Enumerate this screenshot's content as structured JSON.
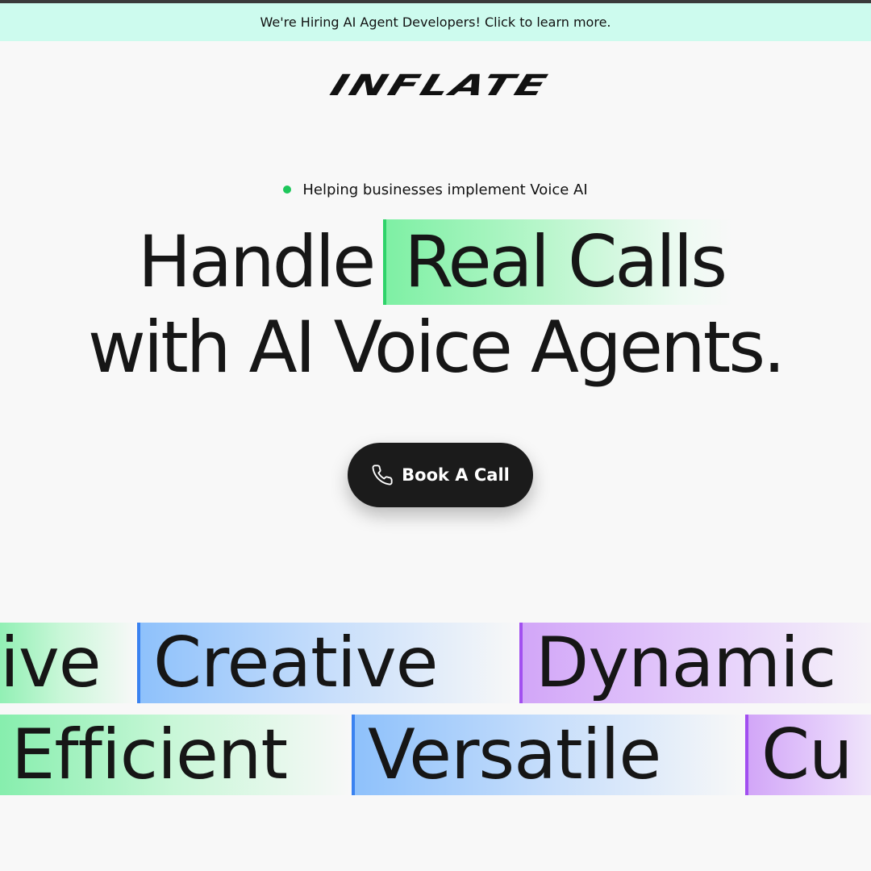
{
  "banner": {
    "text": "We're Hiring AI Agent Developers! Click to learn more."
  },
  "brand": {
    "logo_text": "INFLATE"
  },
  "hero": {
    "tagline": "Helping businesses implement Voice AI",
    "headline_part1": "Handle",
    "headline_highlight": "Real Calls",
    "headline_line2": "with AI Voice Agents.",
    "cta_label": "Book A Call",
    "cta_icon": "phone-icon"
  },
  "marquee": {
    "row1": [
      {
        "word": "ive",
        "color": "green"
      },
      {
        "word": "Creative",
        "color": "blue"
      },
      {
        "word": "Dynamic",
        "color": "purple"
      }
    ],
    "row2": [
      {
        "word": "Efficient",
        "color": "green"
      },
      {
        "word": "Versatile",
        "color": "blue"
      },
      {
        "word": "Cu",
        "color": "purple"
      }
    ]
  },
  "colors": {
    "banner_bg": "#cdfbee",
    "status_dot": "#1ec75b",
    "highlight_green": "#7ef0a4",
    "highlight_blue": "#8ec1fb",
    "highlight_purple": "#d2a6f8",
    "cta_bg": "#1b1b1b"
  }
}
